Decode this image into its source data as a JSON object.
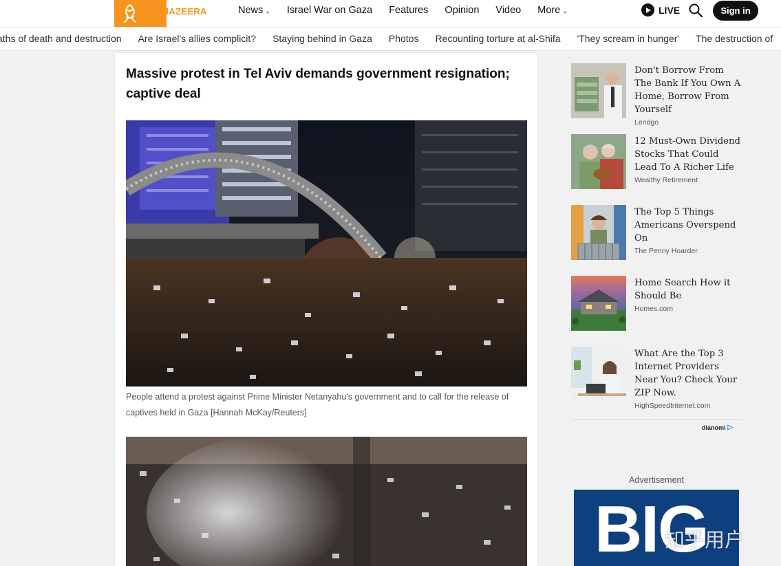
{
  "header": {
    "logo_text": "ALJAZEERA",
    "nav": [
      {
        "label": "News",
        "dropdown": true
      },
      {
        "label": "Israel War on Gaza",
        "dropdown": false
      },
      {
        "label": "Features",
        "dropdown": false
      },
      {
        "label": "Opinion",
        "dropdown": false
      },
      {
        "label": "Video",
        "dropdown": false
      },
      {
        "label": "More",
        "dropdown": true
      }
    ],
    "live_label": "LIVE",
    "signin_label": "Sign in",
    "brand_color": "#f7941d"
  },
  "trending": [
    "aths of death and destruction",
    "Are Israel's allies complicit?",
    "Staying behind in Gaza",
    "Photos",
    "Recounting torture at al-Shifa",
    "'They scream in hunger'",
    "The destruction of"
  ],
  "article": {
    "headline": "Massive protest in Tel Aviv demands government resignation; captive deal",
    "photo1_caption": "People attend a protest against Prime Minister Netanyahu's government and to call for the release of captives held in Gaza [Hannah McKay/Reuters]"
  },
  "sidebar": {
    "promos": [
      {
        "title": "Don't Borrow From The Bank If You Own A Home, Borrow From Yourself",
        "source": "Lendgo"
      },
      {
        "title": "12 Must-Own Dividend Stocks That Could Lead To A Richer Life",
        "source": "Wealthy Retirement"
      },
      {
        "title": "The Top 5 Things Americans Overspend On",
        "source": "The Penny Hoarder"
      },
      {
        "title": "Home Search How it Should Be",
        "source": "Homes.com"
      },
      {
        "title": "What Are the Top 3 Internet Providers Near You? Check Your ZIP Now.",
        "source": "HighSpeedInternet.com"
      }
    ],
    "promo_provider": "dianomi",
    "ad_label": "Advertisement",
    "ad_text": "BIG"
  },
  "watermark": "知乎用户"
}
